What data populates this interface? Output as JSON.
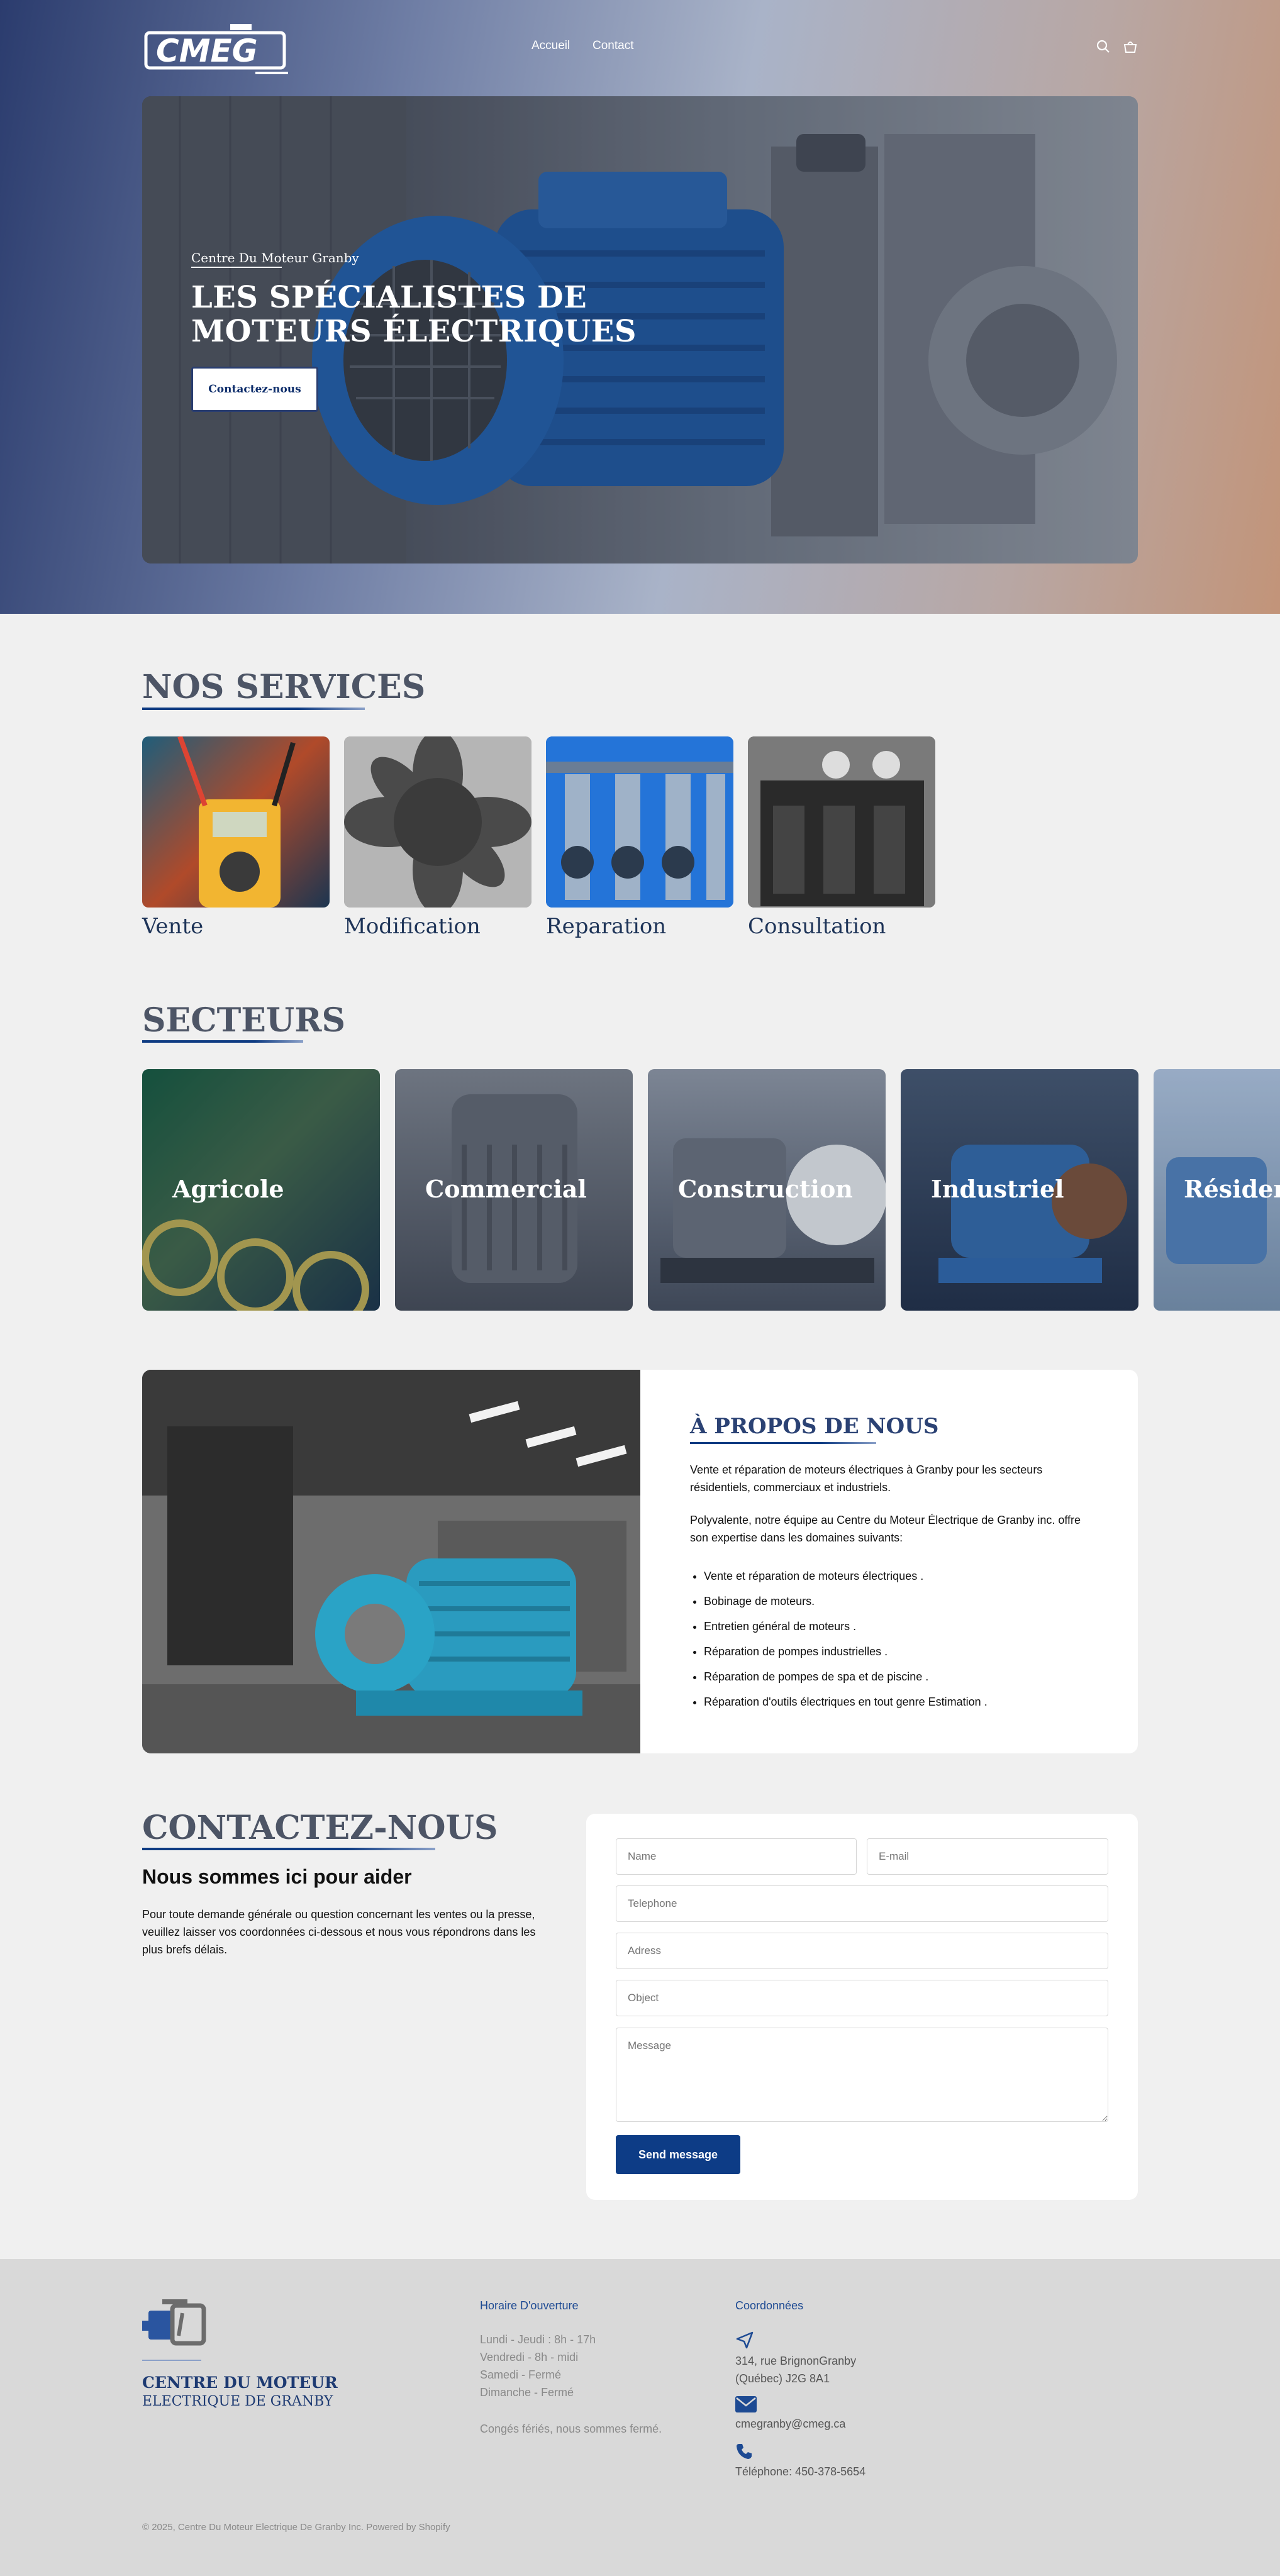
{
  "header": {
    "logo_text": "CMEG",
    "nav": [
      "Accueil",
      "Contact"
    ],
    "icons": [
      "search-icon",
      "cart-icon"
    ]
  },
  "hero": {
    "eyebrow": "Centre Du Moteur Granby",
    "title": "LES SPÉCIALISTES DE MOTEURS ÉLECTRIQUES",
    "button": "Contactez-nous"
  },
  "services": {
    "title": "NOS SERVICES",
    "items": [
      "Vente",
      "Modification",
      "Reparation",
      "Consultation"
    ]
  },
  "secteurs": {
    "title": "SECTEURS",
    "items": [
      "Agricole",
      "Commercial",
      "Construction",
      "Industriel",
      "Résidentiel"
    ]
  },
  "about": {
    "title": "À PROPOS DE NOUS",
    "p1": "Vente et réparation de moteurs électriques à Granby pour les secteurs résidentiels, commerciaux et industriels.",
    "p2": "Polyvalente, notre équipe au Centre du Moteur Électrique de Granby inc. offre son expertise dans les domaines suivants:",
    "list": [
      "Vente et réparation de moteurs électriques .",
      "Bobinage de moteurs.",
      "Entretien général de moteurs .",
      "Réparation de pompes industrielles .",
      "Réparation de pompes de spa et de piscine .",
      "Réparation d'outils électriques en tout genre Estimation ."
    ]
  },
  "contact": {
    "title": "CONTACTEZ-NOUS",
    "subtitle": "Nous sommes ici pour aider",
    "text": "Pour toute demande générale ou question concernant les ventes ou la presse, veuillez laisser vos coordonnées ci-dessous et nous vous répondrons dans les plus brefs délais.",
    "form": {
      "name": "Name",
      "email": "E-mail",
      "telephone": "Telephone",
      "adress": "Adress",
      "object": "Object",
      "message": "Message",
      "submit": "Send message"
    }
  },
  "footer": {
    "brand1": "CENTRE DU MOTEUR",
    "brand2": "ELECTRIQUE DE GRANBY",
    "hours_title": "Horaire D'ouverture",
    "hours": [
      "Lundi - Jeudi : 8h - 17h",
      "Vendredi - 8h - midi",
      "Samedi - Fermé",
      "Dimanche - Fermé"
    ],
    "holiday": "Congés fériés, nous sommes fermé.",
    "coords_title": "Coordonnées",
    "address1": "314, rue BrignonGranby",
    "address2": "(Québec) J2G 8A1",
    "email": "cmegranby@cmeg.ca",
    "phone": "Téléphone: 450-378-5654",
    "copyright": "© 2025, Centre Du Moteur Electrique De Granby Inc. Powered by Shopify"
  },
  "colors": {
    "brand_blue": "#0d3c86",
    "title_grey": "#4d5566",
    "background": "#f0f0f0",
    "footer_bg": "#d9d9d9"
  }
}
